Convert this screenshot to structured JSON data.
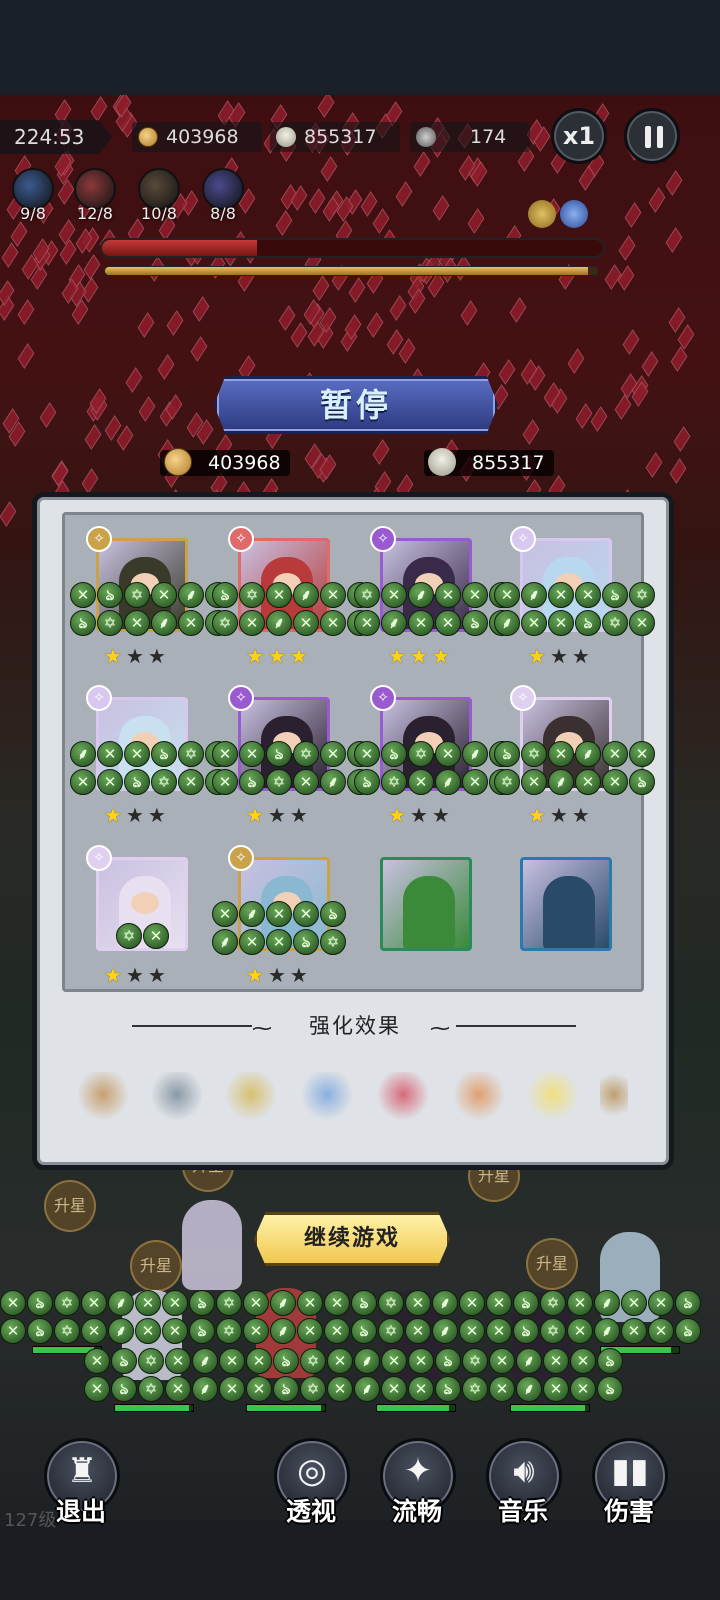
{
  "hud": {
    "timer": "224:53",
    "gold": "403968",
    "kills": "855317",
    "enemies": "174",
    "speed_label": "x1",
    "skills": [
      {
        "icon": "key-skill-icon",
        "count": "9/8",
        "color": "#3b5a8e"
      },
      {
        "icon": "feather-skill-icon",
        "count": "12/8",
        "color": "#8a3a3a"
      },
      {
        "icon": "vortex-skill-icon",
        "count": "10/8",
        "color": "#5a4a3a"
      },
      {
        "icon": "dragon-skill-icon",
        "count": "8/8",
        "color": "#4a4a8e"
      }
    ],
    "boss_hp_fraction": 0.31,
    "exp_fraction": 0.98
  },
  "pause": {
    "title": "暂停",
    "gold": "403968",
    "kills": "855317",
    "section_title": "强化效果",
    "continue_label": "继续游戏"
  },
  "roster": [
    {
      "name": "scythe-hero",
      "class_icon": "sword-class-icon",
      "stars": 1,
      "frame": "#c9a24a",
      "tint": "#3a3a2a"
    },
    {
      "name": "red-hair-hero",
      "class_icon": "blade-class-icon",
      "stars": 3,
      "frame": "#e06a6a",
      "tint": "#b83a3a"
    },
    {
      "name": "hooded-hero",
      "class_icon": "dragon-class-icon",
      "stars": 3,
      "frame": "#9a5ad0",
      "tint": "#3a2a4a"
    },
    {
      "name": "ice-hero",
      "class_icon": "dragon-class-icon",
      "stars": 1,
      "frame": "#d8c8f0",
      "tint": "#b8d8f0"
    },
    {
      "name": "spear-ice-hero",
      "class_icon": "dragon-class-icon",
      "stars": 1,
      "frame": "#d8c8f0",
      "tint": "#c8e0f0"
    },
    {
      "name": "dark-nun-hero",
      "class_icon": "dragon-class-icon",
      "stars": 1,
      "frame": "#9a5ad0",
      "tint": "#2a2030"
    },
    {
      "name": "dark-nun-hero-2",
      "class_icon": "dragon-class-icon",
      "stars": 1,
      "frame": "#9a5ad0",
      "tint": "#2a2030"
    },
    {
      "name": "horned-hero",
      "class_icon": "vortex-class-icon",
      "stars": 1,
      "frame": "#e0d0f0",
      "tint": "#3a3030"
    },
    {
      "name": "horned-girl-hero",
      "class_icon": "vortex-class-icon",
      "stars": 1,
      "frame": "#e0d0f0",
      "tint": "#e8e0f0"
    },
    {
      "name": "crystal-hero",
      "class_icon": "key-class-icon",
      "stars": 1,
      "frame": "#c9a24a",
      "tint": "#8ab8d0"
    },
    {
      "name": "green-slime",
      "class_icon": "",
      "stars": 0,
      "frame": "#2a8a5a",
      "tint": "#3a8a3a"
    },
    {
      "name": "bat-blob",
      "class_icon": "",
      "stars": 0,
      "frame": "#2a7ab0",
      "tint": "#2a4a6a"
    }
  ],
  "buffs": [
    {
      "icon": "puppet-icon",
      "color": "#c8a070"
    },
    {
      "icon": "crossed-swords-icon",
      "color": "#8a9aa8"
    },
    {
      "icon": "hourglass-icon",
      "color": "#d8c070"
    },
    {
      "icon": "magic-sword-icon",
      "color": "#8ab0e0"
    },
    {
      "icon": "spellbook-icon",
      "color": "#d86a7a"
    },
    {
      "icon": "strength-icon",
      "color": "#e0a070"
    },
    {
      "icon": "golden-swords-icon",
      "color": "#f0e080"
    },
    {
      "icon": "partial-buff-icon",
      "color": "#c0a070"
    }
  ],
  "menu": {
    "exit": "退出",
    "xray": "透视",
    "smooth": "流畅",
    "music": "音乐",
    "damage": "伤害"
  },
  "battlefield": {
    "upgrade_label": "升星",
    "level_text": "127级"
  }
}
